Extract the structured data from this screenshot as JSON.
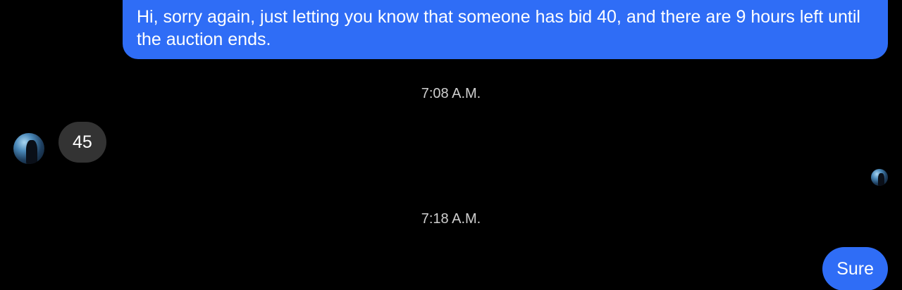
{
  "messages": {
    "outgoing_1": "Hi, sorry again, just letting you know that someone has bid 40, and there are 9 hours left until the auction ends.",
    "timestamp_1": "7:08 A.M.",
    "incoming_1": "45",
    "timestamp_2": "7:18 A.M.",
    "outgoing_2": "Sure"
  },
  "colors": {
    "background": "#000000",
    "outgoing_bubble": "#2f6df6",
    "incoming_bubble": "#333333",
    "timestamp_text": "#cfcfcf"
  },
  "icons": {
    "contact_avatar": "contact-avatar-icon",
    "seen_avatar": "seen-receipt-avatar-icon"
  }
}
